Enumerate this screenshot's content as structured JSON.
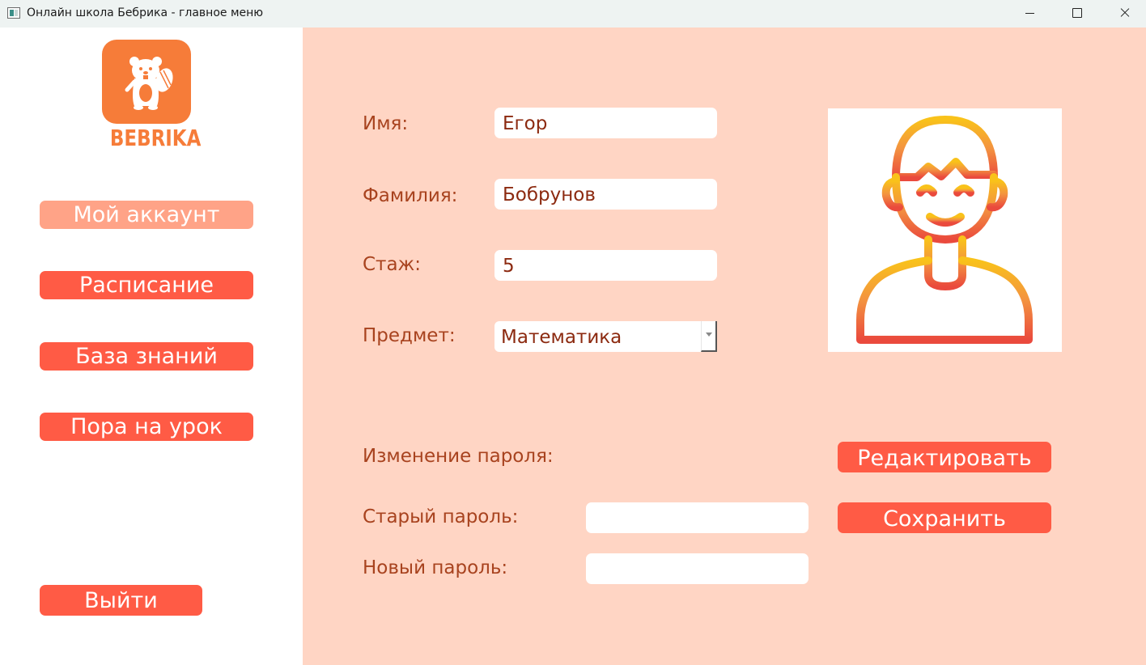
{
  "window": {
    "title": "Онлайн школа Бебрика - главное меню",
    "controls": [
      "minimize-icon",
      "maximize-icon",
      "close-icon"
    ]
  },
  "sidebar": {
    "logo_text": "BEBRIKA",
    "nav": {
      "account": "Мой аккаунт",
      "schedule": "Расписание",
      "knowledge_base": "База знаний",
      "lesson": "Пора на урок",
      "exit": "Выйти"
    },
    "active_item": "account"
  },
  "profile": {
    "name_label": "Имя:",
    "name_value": "Егор",
    "surname_label": "Фамилия:",
    "surname_value": "Бобрунов",
    "experience_label": "Стаж:",
    "experience_value": "5",
    "subject_label": "Предмет:",
    "subject_value": "Математика",
    "avatar_icon": "user-avatar-icon"
  },
  "password": {
    "section_label": "Изменение пароля:",
    "old_label": "Старый пароль:",
    "old_value": "",
    "new_label": "Новый пароль:",
    "new_value": ""
  },
  "actions": {
    "edit": "Редактировать",
    "save": "Сохранить"
  },
  "colors": {
    "accent": "#ff5b45",
    "active_nav": "#ffa387",
    "main_background": "#ffd5c4",
    "label_text": "#a8431f",
    "logo_orange": "#f67c39"
  }
}
